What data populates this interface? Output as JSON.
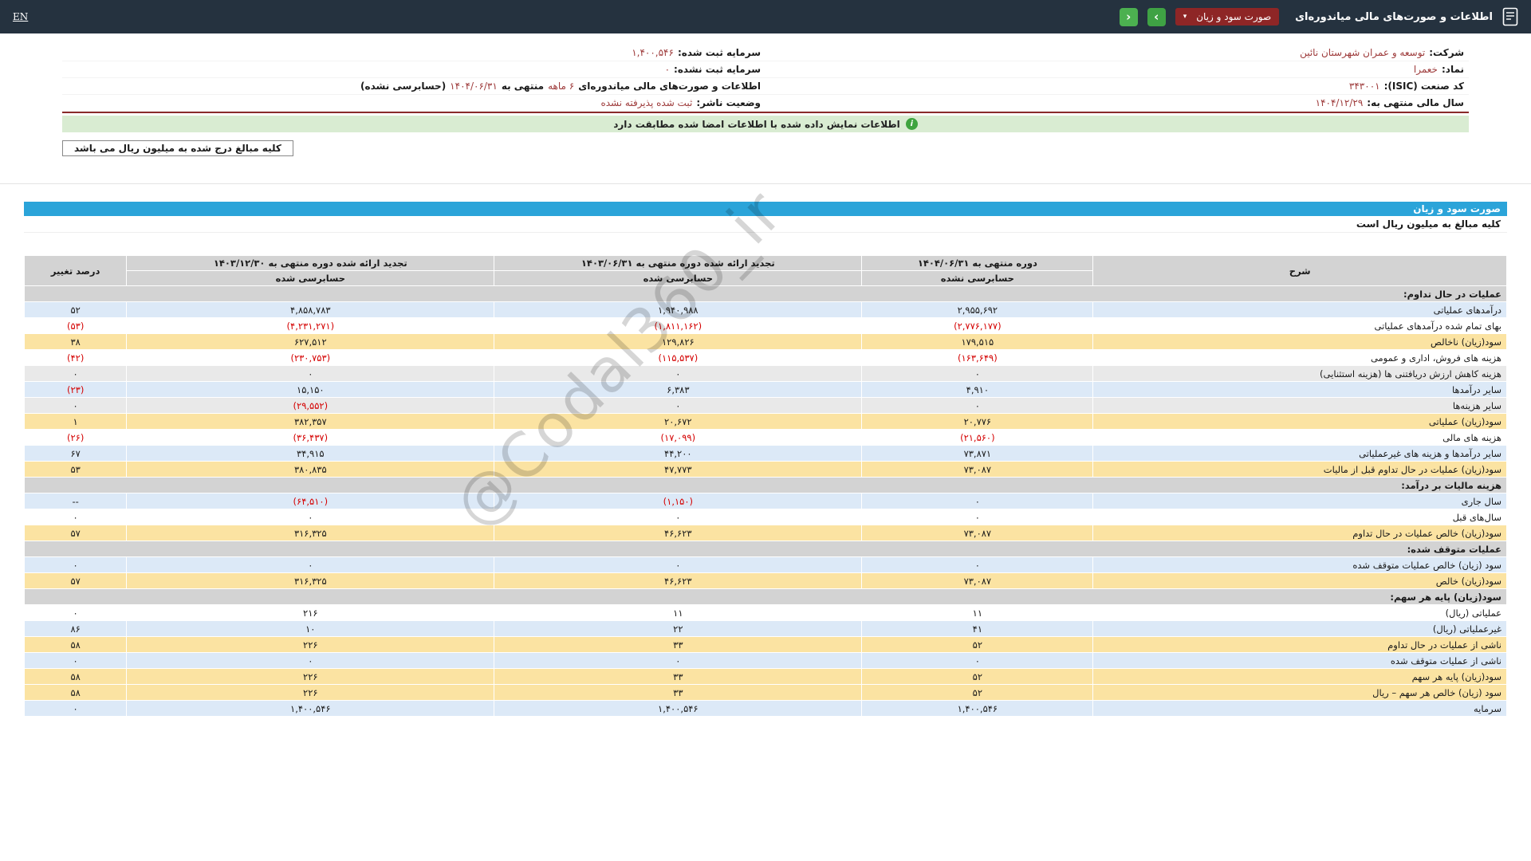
{
  "top_bar": {
    "title": "اطلاعات و صورت‌های مالی میاندوره‌ای",
    "statement_dropdown": "صورت سود و زیان",
    "caret": "▾",
    "nav": {
      "forward": "›",
      "back": "‹"
    },
    "en_label": "EN"
  },
  "company_info": {
    "right": [
      {
        "label": "شرکت:",
        "value": "توسعه و عمران شهرستان نائین"
      },
      {
        "label": "نماد:",
        "value": "خعمرا"
      },
      {
        "label": "کد صنعت (ISIC):",
        "value": "۳۴۳۰۰۱"
      },
      {
        "label": "سال مالی منتهی به:",
        "value": "۱۴۰۴/۱۲/۲۹"
      }
    ],
    "left": [
      {
        "label": "سرمایه ثبت شده:",
        "value": "۱,۴۰۰,۵۴۶"
      },
      {
        "label": "سرمایه ثبت نشده:",
        "value": "۰"
      },
      {
        "label": "وضعیت ناشر:",
        "value": "ثبت شده پذیرفته نشده"
      }
    ],
    "period_line": {
      "prefix": "اطلاعات و صورت‌های مالی میاندوره‌ای",
      "duration": "۶ ماهه",
      "middle": "منتهی به",
      "date": "۱۴۰۴/۰۶/۳۱",
      "suffix": "(حسابرسی نشده)"
    }
  },
  "banner": {
    "icon": "i",
    "text": "اطلاعات نمایش داده شده با اطلاعات امضا شده مطابقت دارد"
  },
  "amounts_box_text": "کلیه مبالغ درج شده به میلیون ریال می باشد",
  "statement": {
    "section_title": "صورت سود و زیان",
    "amounts_note": "کلیه مبالغ به میلیون ریال است",
    "columns": {
      "description": "شرح",
      "period_current": "دوره منتهی به ۱۴۰۴/۰۶/۳۱",
      "period_current_sub": "حسابرسی نشده",
      "period_prev": "تجدید ارائه شده دوره منتهی به ۱۴۰۳/۰۶/۳۱",
      "period_prev_sub": "حسابرسی شده",
      "period_year": "تجدید ارائه شده دوره منتهی به ۱۴۰۳/۱۲/۳۰",
      "period_year_sub": "حسابرسی شده",
      "change": "درصد تغییر"
    },
    "rows": [
      {
        "type": "section",
        "label": "عملیات در حال تداوم:",
        "style": "section"
      },
      {
        "type": "data",
        "label": "درآمدهای عملیاتی",
        "values": [
          "۲,۹۵۵,۶۹۲",
          "۱,۹۴۰,۹۸۸",
          "۴,۸۵۸,۷۸۳"
        ],
        "change": "۵۲",
        "style": "blue"
      },
      {
        "type": "data",
        "label": "بهای تمام شده درآمدهای عملیاتی",
        "values": [
          "(۲,۷۷۶,۱۷۷)",
          "(۱,۸۱۱,۱۶۲)",
          "(۴,۲۳۱,۲۷۱)"
        ],
        "change": "(۵۳)",
        "style": "white"
      },
      {
        "type": "data",
        "label": "سود(زیان) ناخالص",
        "values": [
          "۱۷۹,۵۱۵",
          "۱۲۹,۸۲۶",
          "۶۲۷,۵۱۲"
        ],
        "change": "۳۸",
        "style": "yellow"
      },
      {
        "type": "data",
        "label": "هزینه های فروش، اداری و عمومی",
        "values": [
          "(۱۶۳,۶۴۹)",
          "(۱۱۵,۵۳۷)",
          "(۲۳۰,۷۵۳)"
        ],
        "change": "(۴۲)",
        "style": "white"
      },
      {
        "type": "data",
        "label": "هزینه کاهش ارزش دریافتنی ها (هزینه استثنایی)",
        "values": [
          "۰",
          "۰",
          "۰"
        ],
        "change": "۰",
        "style": "gray"
      },
      {
        "type": "data",
        "label": "سایر درآمدها",
        "values": [
          "۴,۹۱۰",
          "۶,۳۸۳",
          "۱۵,۱۵۰"
        ],
        "change": "(۲۳)",
        "style": "blue"
      },
      {
        "type": "data",
        "label": "سایر هزینه‌ها",
        "values": [
          "۰",
          "۰",
          "(۲۹,۵۵۲)"
        ],
        "change": "۰",
        "style": "gray"
      },
      {
        "type": "data",
        "label": "سود(زیان) عملیاتی",
        "values": [
          "۲۰,۷۷۶",
          "۲۰,۶۷۲",
          "۳۸۲,۳۵۷"
        ],
        "change": "۱",
        "style": "yellow"
      },
      {
        "type": "data",
        "label": "هزینه های مالی",
        "values": [
          "(۲۱,۵۶۰)",
          "(۱۷,۰۹۹)",
          "(۳۶,۴۳۷)"
        ],
        "change": "(۲۶)",
        "style": "white"
      },
      {
        "type": "data",
        "label": "سایر درآمدها و هزینه های غیرعملیاتی",
        "values": [
          "۷۳,۸۷۱",
          "۴۴,۲۰۰",
          "۳۴,۹۱۵"
        ],
        "change": "۶۷",
        "style": "blue"
      },
      {
        "type": "data",
        "label": "سود(زیان) عملیات در حال تداوم قبل از مالیات",
        "values": [
          "۷۳,۰۸۷",
          "۴۷,۷۷۳",
          "۳۸۰,۸۳۵"
        ],
        "change": "۵۳",
        "style": "yellow"
      },
      {
        "type": "section",
        "label": "هزینه مالیات بر درآمد:",
        "style": "section"
      },
      {
        "type": "data",
        "label": "سال جاری",
        "values": [
          "۰",
          "(۱,۱۵۰)",
          "(۶۴,۵۱۰)"
        ],
        "change": "--",
        "style": "blue"
      },
      {
        "type": "data",
        "label": "سال‌های قبل",
        "values": [
          "۰",
          "۰",
          "۰"
        ],
        "change": "۰",
        "style": "white"
      },
      {
        "type": "data",
        "label": "سود(زیان) خالص عملیات در حال تداوم",
        "values": [
          "۷۳,۰۸۷",
          "۴۶,۶۲۳",
          "۳۱۶,۳۲۵"
        ],
        "change": "۵۷",
        "style": "yellow"
      },
      {
        "type": "section",
        "label": "عملیات متوقف شده:",
        "style": "section"
      },
      {
        "type": "data",
        "label": "سود (زیان) خالص عملیات متوقف شده",
        "values": [
          "۰",
          "۰",
          "۰"
        ],
        "change": "۰",
        "style": "blue"
      },
      {
        "type": "data",
        "label": "سود(زیان) خالص",
        "values": [
          "۷۳,۰۸۷",
          "۴۶,۶۲۳",
          "۳۱۶,۳۲۵"
        ],
        "change": "۵۷",
        "style": "yellow"
      },
      {
        "type": "section",
        "label": "سود(زیان) پایه هر سهم:",
        "style": "section"
      },
      {
        "type": "data",
        "label": "عملیاتی (ریال)",
        "values": [
          "۱۱",
          "۱۱",
          "۲۱۶"
        ],
        "change": "۰",
        "style": "white"
      },
      {
        "type": "data",
        "label": "غیرعملیاتی (ریال)",
        "values": [
          "۴۱",
          "۲۲",
          "۱۰"
        ],
        "change": "۸۶",
        "style": "blue"
      },
      {
        "type": "data",
        "label": "ناشی از عملیات در حال تداوم",
        "values": [
          "۵۲",
          "۳۳",
          "۲۲۶"
        ],
        "change": "۵۸",
        "style": "yellow"
      },
      {
        "type": "data",
        "label": "ناشی از عملیات متوقف شده",
        "values": [
          "۰",
          "۰",
          "۰"
        ],
        "change": "۰",
        "style": "blue"
      },
      {
        "type": "data",
        "label": "سود(زیان) پایه هر سهم",
        "values": [
          "۵۲",
          "۳۳",
          "۲۲۶"
        ],
        "change": "۵۸",
        "style": "yellow"
      },
      {
        "type": "data",
        "label": "سود (زیان) خالص هر سهم – ریال",
        "values": [
          "۵۲",
          "۳۳",
          "۲۲۶"
        ],
        "change": "۵۸",
        "style": "yellow"
      },
      {
        "type": "data",
        "label": "سرمایه",
        "values": [
          "۱,۴۰۰,۵۴۶",
          "۱,۴۰۰,۵۴۶",
          "۱,۴۰۰,۵۴۶"
        ],
        "change": "۰",
        "style": "blue"
      }
    ]
  },
  "watermark": "@Codal360_ir",
  "colors": {
    "topbar-bg": "#25323f",
    "dropdown-bg": "#8e2626",
    "nav-green": "#3fa244",
    "banner-green-bg": "#d9ecd2",
    "icon-green": "#3fa43f",
    "section-blue": "#2ba4d9",
    "header-gray": "#d3d3d3",
    "row-blue": "#dce9f7",
    "row-yellow": "#fbe3a2",
    "row-gray": "#e9e9e9",
    "negative-red": "#d40000",
    "info-value-maroon": "#9e3b3b",
    "divider-maroon": "#8a2a2a"
  }
}
